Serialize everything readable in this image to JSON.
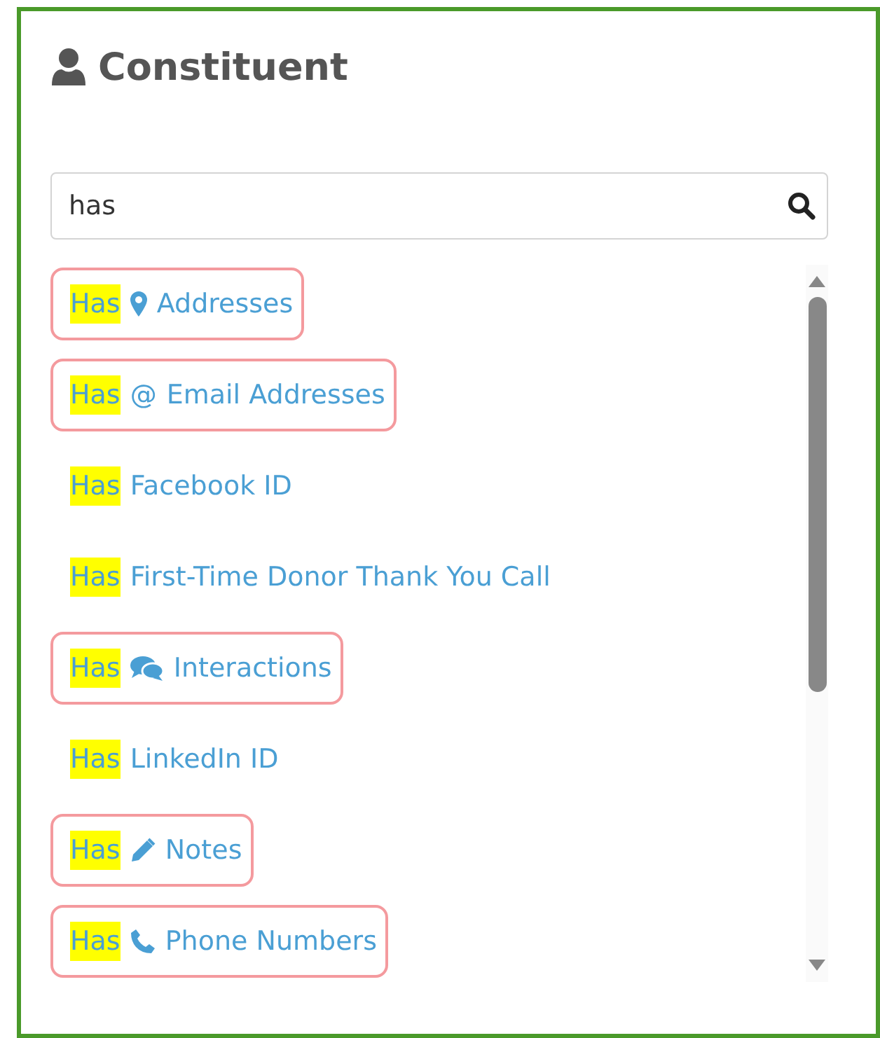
{
  "panel": {
    "title": "Constituent"
  },
  "search": {
    "value": "has"
  },
  "results": [
    {
      "match": "Has",
      "label": "Addresses",
      "kind": "address",
      "outlined": true
    },
    {
      "match": "Has",
      "label": "Email Addresses",
      "kind": "email",
      "symbol": "@",
      "outlined": true
    },
    {
      "match": "Has",
      "label": "Facebook ID",
      "kind": "plain",
      "outlined": false
    },
    {
      "match": "Has",
      "label": "First-Time Donor Thank You Call",
      "kind": "plain",
      "outlined": false
    },
    {
      "match": "Has",
      "label": "Interactions",
      "kind": "interaction",
      "outlined": true
    },
    {
      "match": "Has",
      "label": "LinkedIn ID",
      "kind": "plain",
      "outlined": false
    },
    {
      "match": "Has",
      "label": "Notes",
      "kind": "note",
      "outlined": true
    },
    {
      "match": "Has",
      "label": "Phone Numbers",
      "kind": "phone",
      "outlined": true
    }
  ]
}
